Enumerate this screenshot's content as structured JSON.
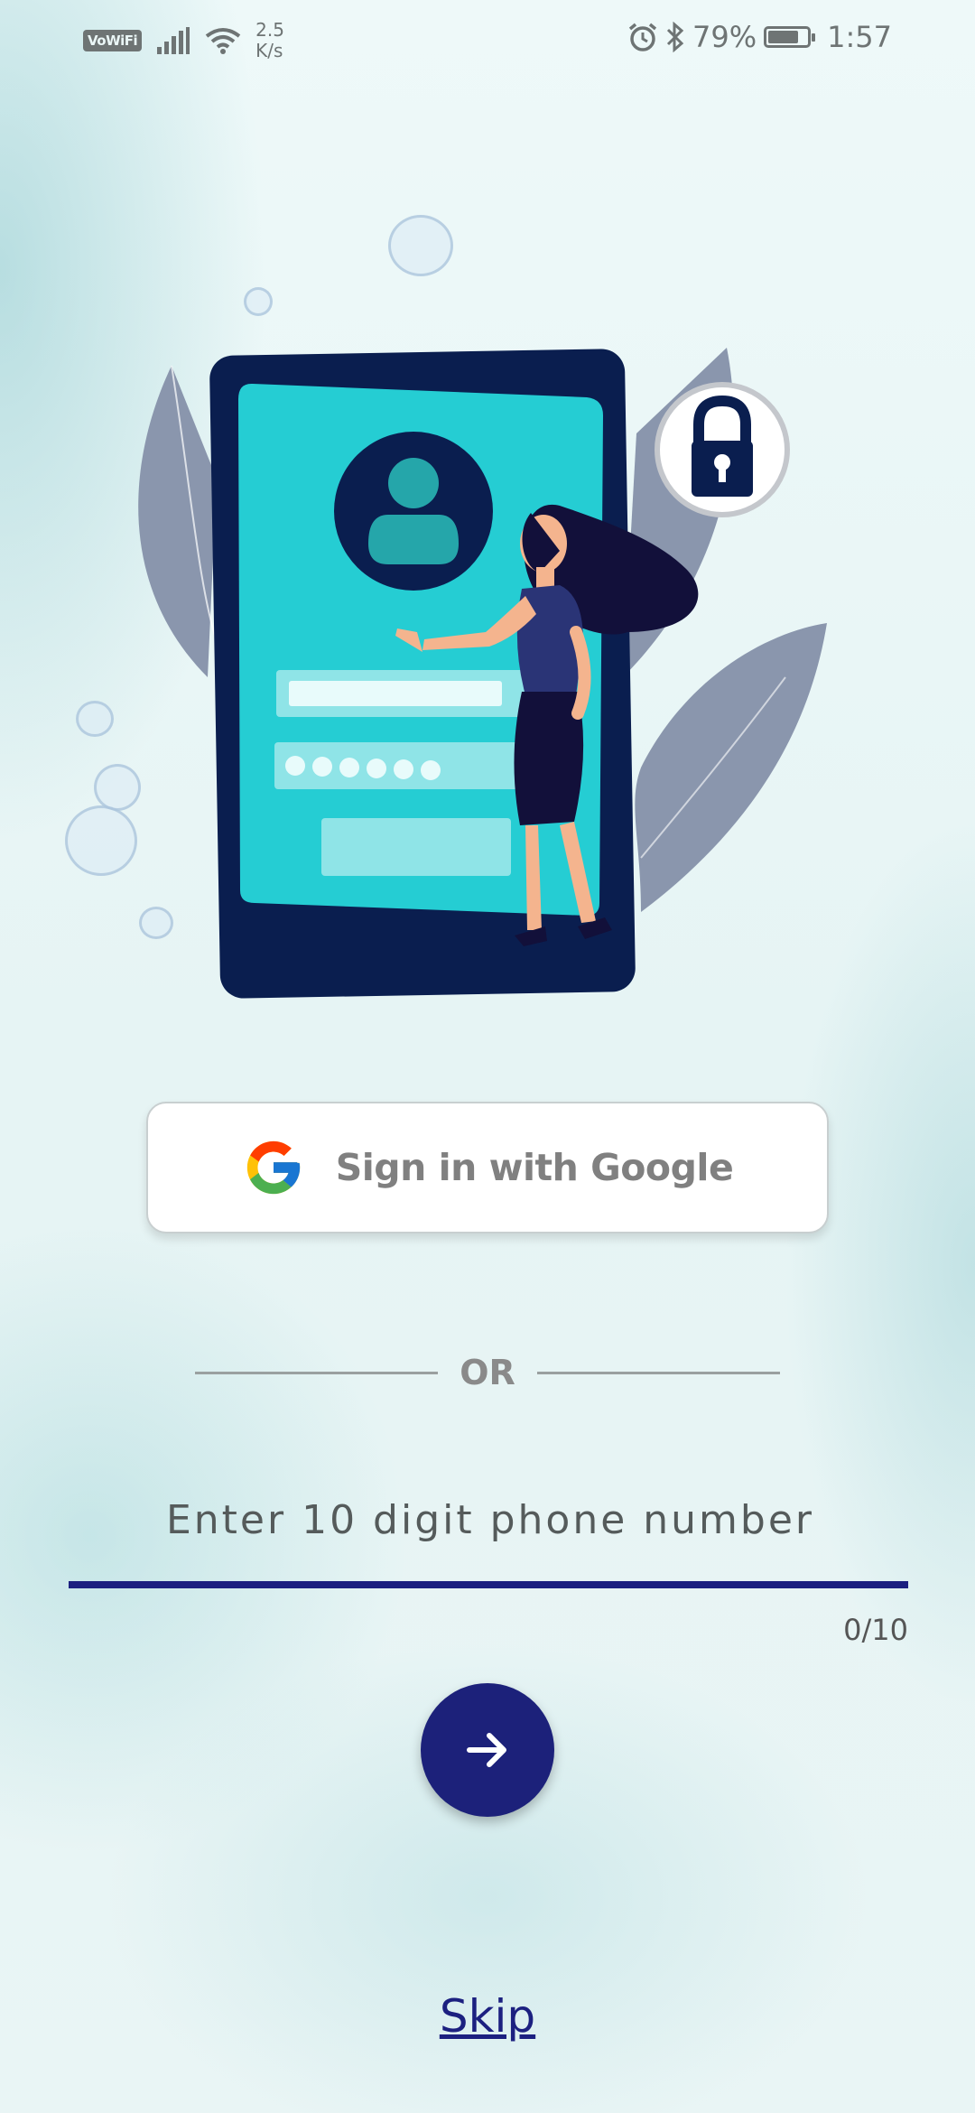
{
  "status_bar": {
    "vowifi_badge": "VoWiFi",
    "net_speed_value": "2.5",
    "net_speed_unit": "K/s",
    "battery_percent": "79%",
    "battery_level": 0.79,
    "time": "1:57",
    "icons": [
      "signal-icon",
      "wifi-icon",
      "alarm-icon",
      "bluetooth-icon",
      "battery-icon"
    ]
  },
  "illustration": {
    "description_icons": [
      "phone-illustration",
      "lock-icon",
      "user-avatar-icon",
      "woman-figure"
    ],
    "colors": {
      "phone_body": "#0a1e4f",
      "screen": "#25cdd3",
      "leaf": "#8a96ad",
      "field": "#8fe4e7"
    }
  },
  "login": {
    "google_button_label": "Sign in with Google",
    "or_label": "OR",
    "phone_placeholder": "Enter 10 digit phone number",
    "phone_value": "",
    "counter": "0/10",
    "skip_label": "Skip"
  },
  "colors": {
    "accent": "#1c217a",
    "underline": "#1c2080",
    "background": "#eaf6f6"
  }
}
